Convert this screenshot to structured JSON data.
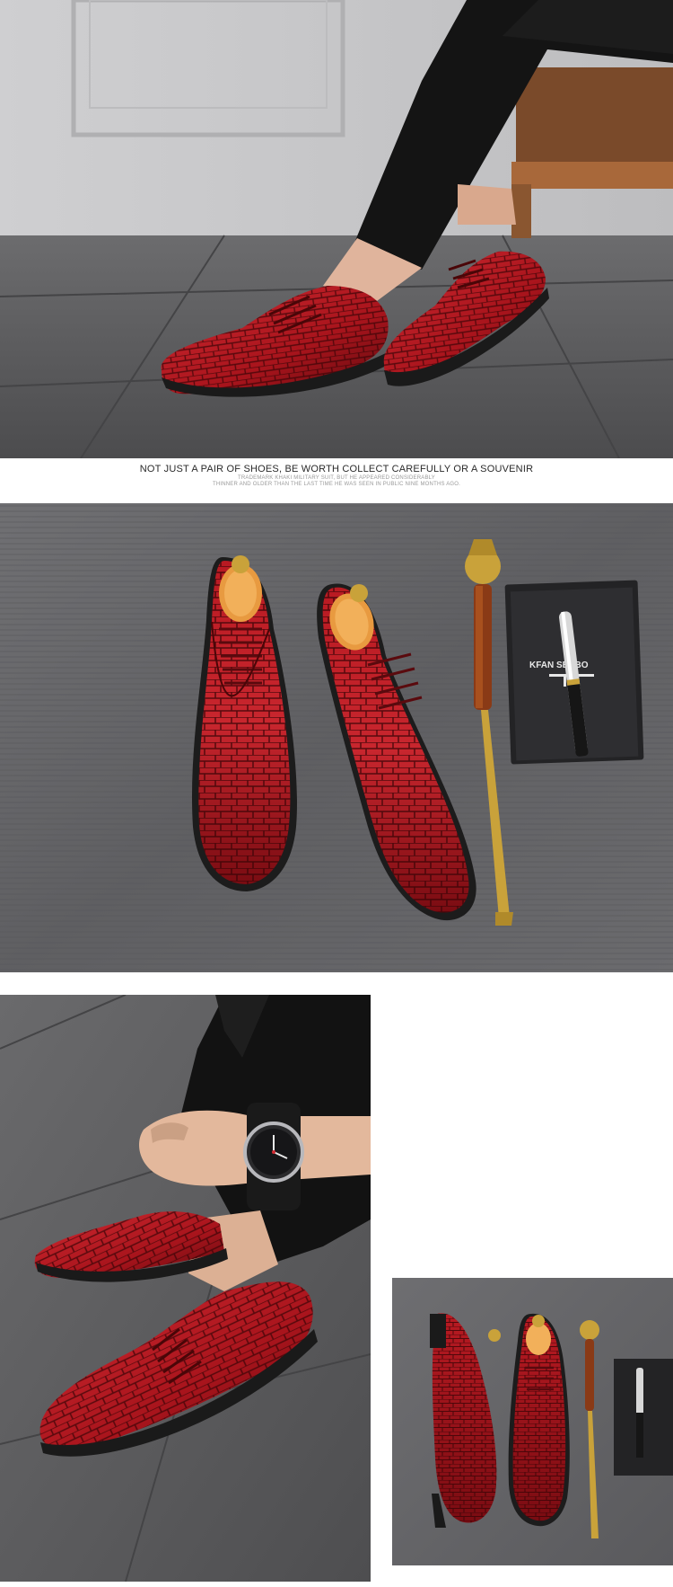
{
  "banner": {
    "tagline": "NOT JUST A PAIR OF SHOES, BE WORTH COLLECT CAREFULLY OR A SOUVENIR",
    "subline_1": "TRADEMARK KHAKI MILITARY SUIT, BUT HE APPEARED CONSIDERABLY",
    "subline_2": "THINNER AND OLDER THAN THE LAST TIME HE WAS SEEN IN PUBLIC NINE MONTHS AGO."
  },
  "box_brand": "KFAN SENBO",
  "colors": {
    "shoe_red": "#a8141c",
    "shoe_dark": "#6a0a10",
    "floor_gray": "#5e5e60",
    "wall_gray": "#c9c9cb",
    "box_black": "#262628",
    "gold": "#c9a23a",
    "wood": "#d68a3a"
  },
  "icons": [
    "oxford-shoe-icon",
    "shoe-horn-icon",
    "pen-icon",
    "gift-box-icon",
    "wristwatch-icon"
  ]
}
